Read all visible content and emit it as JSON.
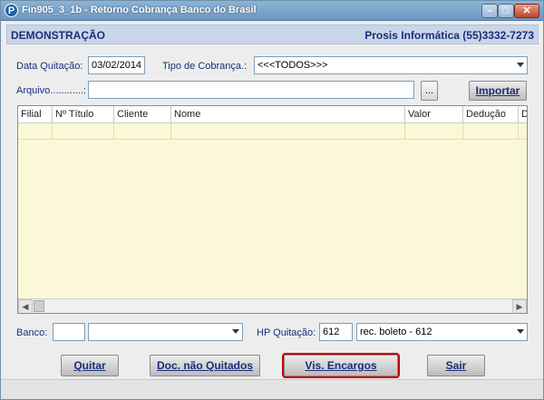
{
  "window": {
    "title": "Fin905_3_1b - Retorno Cobrança Banco do Brasil",
    "icon_letter": "P",
    "controls": {
      "minimize": "–",
      "maximize": "□",
      "close": "✕"
    }
  },
  "header": {
    "left": "DEMONSTRAÇÃO",
    "right": "Prosis Informática (55)3332-7273"
  },
  "form": {
    "data_quitacao_label": "Data Quitação:",
    "data_quitacao_value": "03/02/2014",
    "tipo_cobranca_label": "Tipo de Cobrança.:",
    "tipo_cobranca_value": "<<<TODOS>>>",
    "arquivo_label": "Arquivo............:",
    "arquivo_value": "",
    "browse_label": "...",
    "importar_label": "Importar"
  },
  "grid": {
    "columns": [
      "Filial",
      "Nº Título",
      "Cliente",
      "Nome",
      "Valor",
      "Dedução",
      "D"
    ]
  },
  "bottom": {
    "banco_label": "Banco:",
    "banco_code": "",
    "banco_name": "",
    "hp_label": "HP Quitação:",
    "hp_value": "612",
    "hp_desc": "rec. boleto  - 612"
  },
  "actions": {
    "quitar": "Quitar",
    "doc_nao_quitados": "Doc. não Quitados",
    "vis_encargos": "Vis. Encargos",
    "sair": "Sair"
  }
}
